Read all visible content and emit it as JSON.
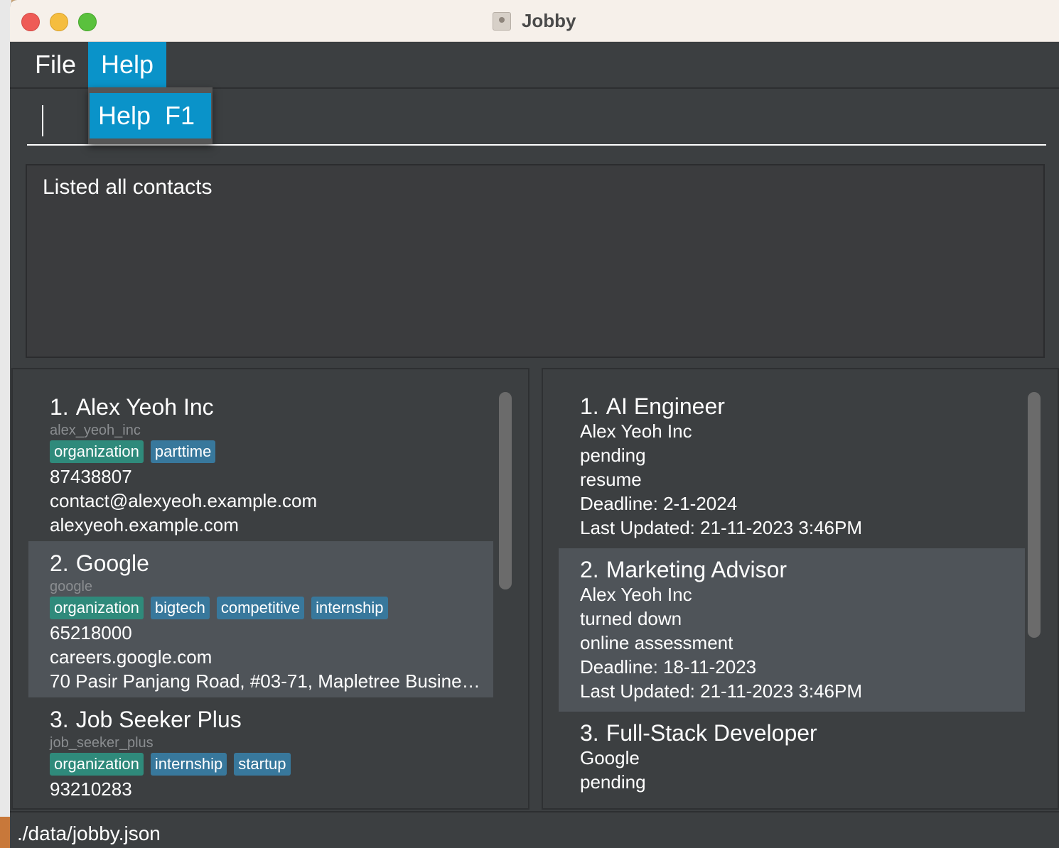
{
  "window": {
    "title": "Jobby"
  },
  "menubar": {
    "file": "File",
    "help": "Help"
  },
  "help_menu": {
    "item": "Help  F1"
  },
  "result_display": "Listed all contacts",
  "contacts": [
    {
      "index": "1.",
      "name": "Alex Yeoh Inc",
      "id": "alex_yeoh_inc",
      "tags": [
        {
          "label": "organization",
          "kind": "org"
        },
        {
          "label": "parttime",
          "kind": "other"
        }
      ],
      "lines": [
        "87438807",
        "contact@alexyeoh.example.com",
        "alexyeoh.example.com"
      ]
    },
    {
      "index": "2.",
      "name": "Google",
      "id": "google",
      "tags": [
        {
          "label": "organization",
          "kind": "org"
        },
        {
          "label": "bigtech",
          "kind": "other"
        },
        {
          "label": "competitive",
          "kind": "other"
        },
        {
          "label": "internship",
          "kind": "other"
        }
      ],
      "lines": [
        "65218000",
        "careers.google.com",
        "70 Pasir Panjang Road, #03-71, Mapletree Business Ci..."
      ]
    },
    {
      "index": "3.",
      "name": "Job Seeker Plus",
      "id": "job_seeker_plus",
      "tags": [
        {
          "label": "organization",
          "kind": "org"
        },
        {
          "label": "internship",
          "kind": "other"
        },
        {
          "label": "startup",
          "kind": "other"
        }
      ],
      "lines": [
        "93210283"
      ]
    }
  ],
  "applications": [
    {
      "index": "1.",
      "title": "AI Engineer",
      "lines": [
        "Alex Yeoh Inc",
        "pending",
        "resume",
        "Deadline: 2-1-2024",
        "Last Updated: 21-11-2023 3:46PM"
      ]
    },
    {
      "index": "2.",
      "title": "Marketing Advisor",
      "lines": [
        "Alex Yeoh Inc",
        "turned down",
        "online assessment",
        "Deadline: 18-11-2023",
        "Last Updated: 21-11-2023 3:46PM"
      ]
    },
    {
      "index": "3.",
      "title": "Full-Stack Developer",
      "lines": [
        "Google",
        "pending"
      ]
    }
  ],
  "status_bar": {
    "path": "./data/jobby.json"
  },
  "colors": {
    "accent": "#0a93c9",
    "tag_org": "#2f8a7b",
    "tag_other": "#38789c",
    "card_alt": "#4f5459",
    "bg": "#3c3f41"
  }
}
